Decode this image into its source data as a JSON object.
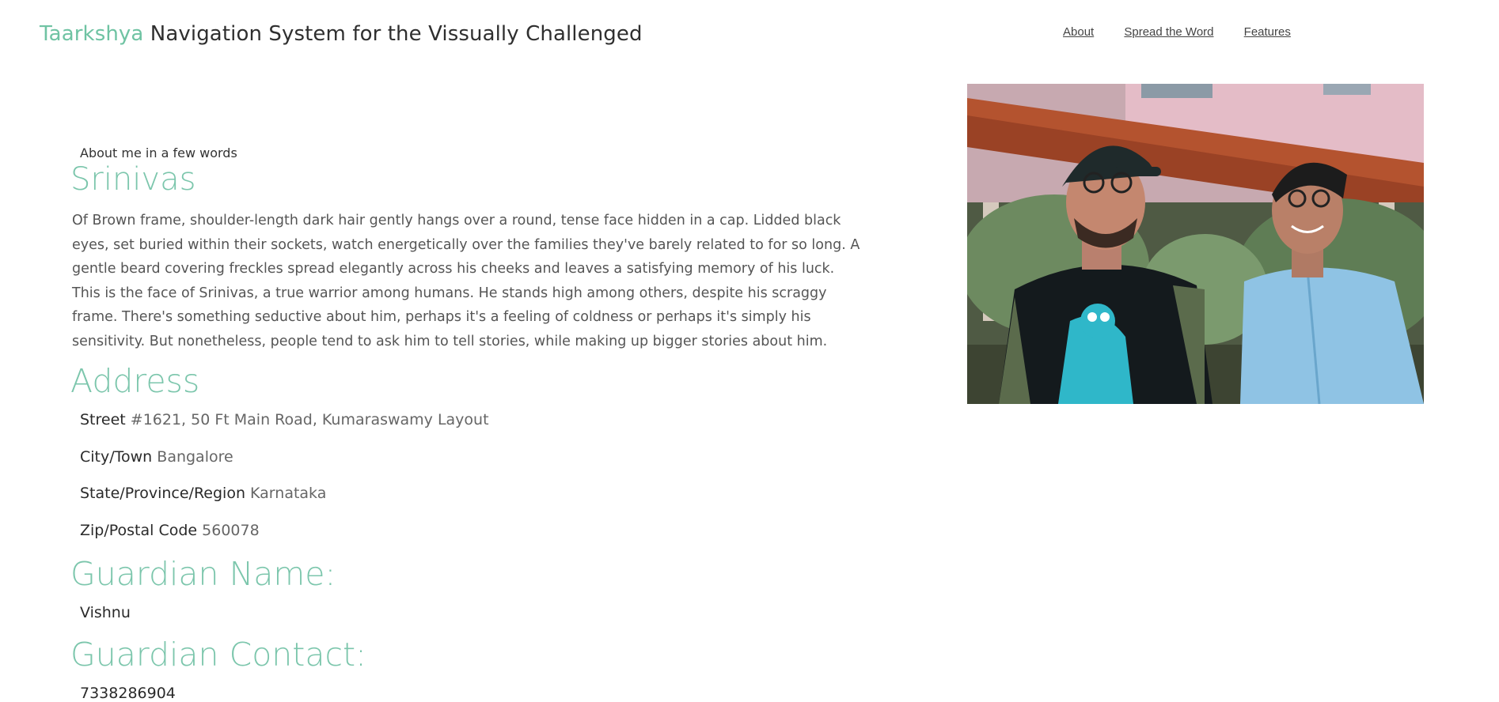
{
  "header": {
    "brand": "Taarkshya",
    "title_rest": " Navigation System for the Vissually Challenged"
  },
  "nav": {
    "items": [
      {
        "label": "About"
      },
      {
        "label": "Spread the Word"
      },
      {
        "label": "Features"
      }
    ]
  },
  "profile": {
    "intro_label": "About me in a few words",
    "name": "Srinivas",
    "bio": "Of Brown frame, shoulder-length dark hair gently hangs over a round, tense face hidden in a cap. Lidded black eyes, set buried within their sockets, watch energetically over the families they've barely related to for so long. A gentle beard covering freckles spread elegantly across his cheeks and leaves a satisfying memory of his luck. This is the face of Srinivas, a true warrior among humans. He stands high among others, despite his scraggy frame. There's something seductive about him, perhaps it's a feeling of coldness or perhaps it's simply his sensitivity. But nonetheless, people tend to ask him to tell stories, while making up bigger stories about him."
  },
  "address": {
    "heading": "Address",
    "street_label": "Street",
    "street_value": "#1621, 50 Ft Main Road, Kumaraswamy Layout",
    "city_label": "City/Town",
    "city_value": "Bangalore",
    "state_label": "State/Province/Region",
    "state_value": "Karnataka",
    "zip_label": "Zip/Postal Code",
    "zip_value": "560078"
  },
  "guardian": {
    "name_heading": "Guardian Name:",
    "name": "Vishnu",
    "contact_heading": "Guardian Contact:",
    "contact": "7338286904"
  },
  "colors": {
    "accent": "#7cc6ac",
    "text": "#333333",
    "muted": "#555555"
  }
}
